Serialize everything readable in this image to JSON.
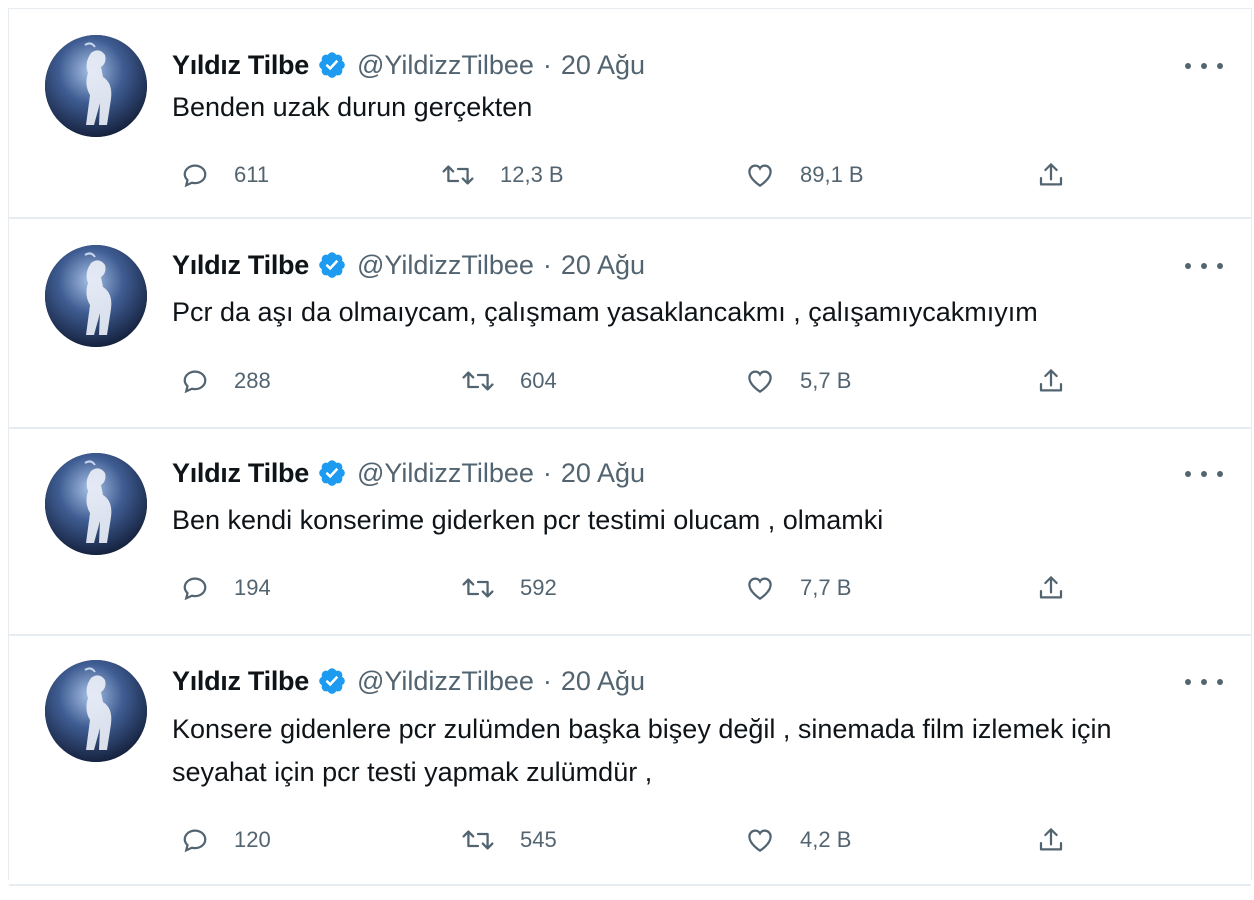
{
  "tweets": [
    {
      "name": "Yıldız Tilbe",
      "handle": "@YildizzTilbee",
      "separator": "·",
      "date": "20 Ağu",
      "text": "Benden uzak durun gerçekten",
      "replies": "611",
      "retweets": "12,3 B",
      "likes": "89,1 B"
    },
    {
      "name": "Yıldız Tilbe",
      "handle": "@YildizzTilbee",
      "separator": "·",
      "date": "20 Ağu",
      "text": "Pcr da aşı da olmaıycam, çalışmam yasaklancakmı , çalışamıycakmıyım",
      "replies": "288",
      "retweets": "604",
      "likes": "5,7 B"
    },
    {
      "name": "Yıldız Tilbe",
      "handle": "@YildizzTilbee",
      "separator": "·",
      "date": "20 Ağu",
      "text": "Ben kendi konserime giderken pcr testimi olucam , olmamki",
      "replies": "194",
      "retweets": "592",
      "likes": "7,7 B"
    },
    {
      "name": "Yıldız Tilbe",
      "handle": "@YildizzTilbee",
      "separator": "·",
      "date": "20 Ağu",
      "text": "Konsere gidenlere pcr zulümden başka bişey değil , sinemada film izlemek için seyahat için pcr testi yapmak zulümdür ,",
      "replies": "120",
      "retweets": "545",
      "likes": "4,2 B"
    }
  ],
  "colors": {
    "verified": "#1d9bf0",
    "secondary_text": "#536471",
    "divider": "#e6ecf0"
  },
  "icons": {
    "reply": "reply-icon",
    "retweet": "retweet-icon",
    "like": "like-icon",
    "share": "share-icon",
    "more": "more-icon",
    "verified": "verified-badge-icon"
  }
}
